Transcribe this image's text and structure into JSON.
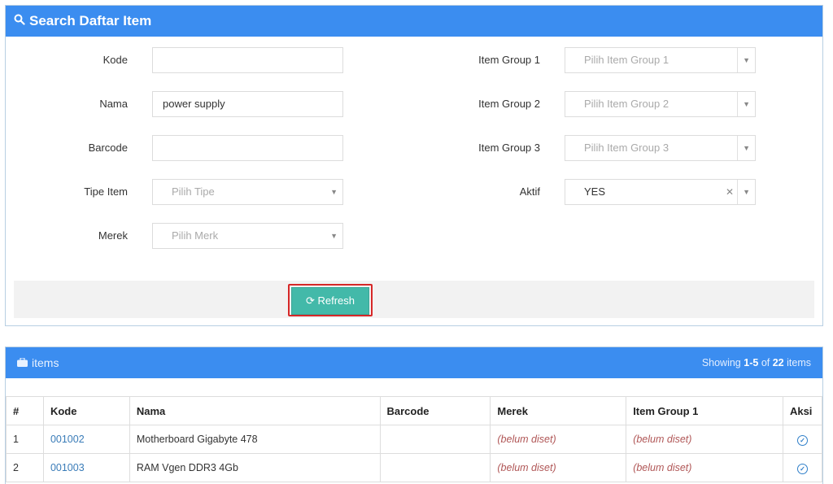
{
  "search": {
    "title": "Search Daftar Item",
    "fields_left": [
      {
        "label": "Kode",
        "value": "",
        "placeholder": ""
      },
      {
        "label": "Nama",
        "value": "power supply",
        "placeholder": ""
      },
      {
        "label": "Barcode",
        "value": "",
        "placeholder": ""
      },
      {
        "label": "Tipe Item",
        "placeholder": "Pilih Tipe"
      },
      {
        "label": "Merek",
        "placeholder": "Pilih Merk"
      }
    ],
    "fields_right": [
      {
        "label": "Item Group 1",
        "placeholder": "Pilih Item Group 1"
      },
      {
        "label": "Item Group 2",
        "placeholder": "Pilih Item Group 2"
      },
      {
        "label": "Item Group 3",
        "placeholder": "Pilih Item Group 3"
      },
      {
        "label": "Aktif",
        "value": "YES"
      }
    ],
    "refresh_label": "Refresh"
  },
  "items": {
    "title": "items",
    "showing_prefix": "Showing",
    "showing_range": "1-5",
    "showing_of": "of",
    "showing_total": "22",
    "showing_suffix": "items",
    "columns": [
      "#",
      "Kode",
      "Nama",
      "Barcode",
      "Merek",
      "Item Group 1",
      "Aksi"
    ],
    "rows": [
      {
        "no": "1",
        "kode": "001002",
        "nama": "Motherboard Gigabyte 478",
        "barcode": "",
        "merek": "(belum diset)",
        "group1": "(belum diset)"
      },
      {
        "no": "2",
        "kode": "001003",
        "nama": "RAM Vgen DDR3 4Gb",
        "barcode": "",
        "merek": "(belum diset)",
        "group1": "(belum diset)"
      }
    ]
  },
  "icons": {
    "search": "search-icon",
    "refresh": "refresh-icon",
    "briefcase": "briefcase-icon",
    "check": "check-circle-icon",
    "caret": "caret-down-icon",
    "clear": "clear-icon"
  },
  "colors": {
    "header_blue": "#3b8df0",
    "refresh_button": "#43b9a9",
    "highlight_border": "#d62828",
    "link": "#3a7cb8",
    "unset_text": "#b05656"
  }
}
